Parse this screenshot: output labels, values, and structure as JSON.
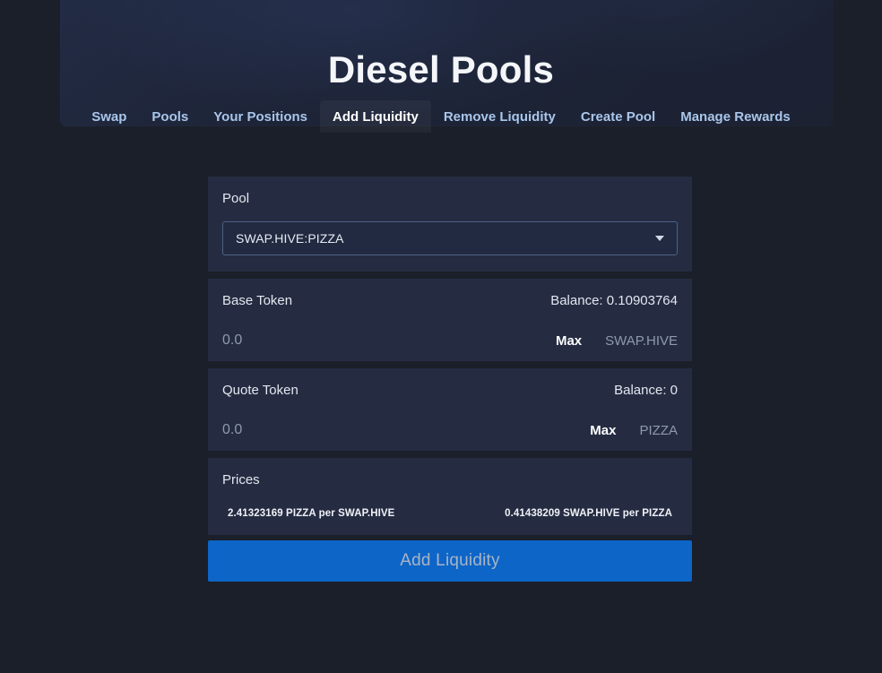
{
  "header": {
    "title": "Diesel Pools"
  },
  "nav": {
    "items": [
      {
        "label": "Swap",
        "active": false
      },
      {
        "label": "Pools",
        "active": false
      },
      {
        "label": "Your Positions",
        "active": false
      },
      {
        "label": "Add Liquidity",
        "active": true
      },
      {
        "label": "Remove Liquidity",
        "active": false
      },
      {
        "label": "Create Pool",
        "active": false
      },
      {
        "label": "Manage Rewards",
        "active": false
      }
    ]
  },
  "form": {
    "pool": {
      "label": "Pool",
      "selected": "SWAP.HIVE:PIZZA",
      "caret_icon": "chevron-down-icon"
    },
    "base_token": {
      "label": "Base Token",
      "balance": "Balance: 0.10903764",
      "amount_value": "",
      "amount_placeholder": "0.0",
      "max_label": "Max",
      "symbol": "SWAP.HIVE"
    },
    "quote_token": {
      "label": "Quote Token",
      "balance": "Balance: 0",
      "amount_value": "",
      "amount_placeholder": "0.0",
      "max_label": "Max",
      "symbol": "PIZZA"
    },
    "prices": {
      "label": "Prices",
      "base_per_quote": "2.41323169 PIZZA per SWAP.HIVE",
      "quote_per_base": "0.41438209 SWAP.HIVE per PIZZA"
    },
    "submit_label": "Add Liquidity"
  },
  "colors": {
    "page_background": "#1b1f29",
    "card_background": "#252c42",
    "banner_background": "#1e2434",
    "accent_button": "#0d65c8",
    "nav_link": "#a9c6ea",
    "muted_text": "#8d99ae"
  }
}
